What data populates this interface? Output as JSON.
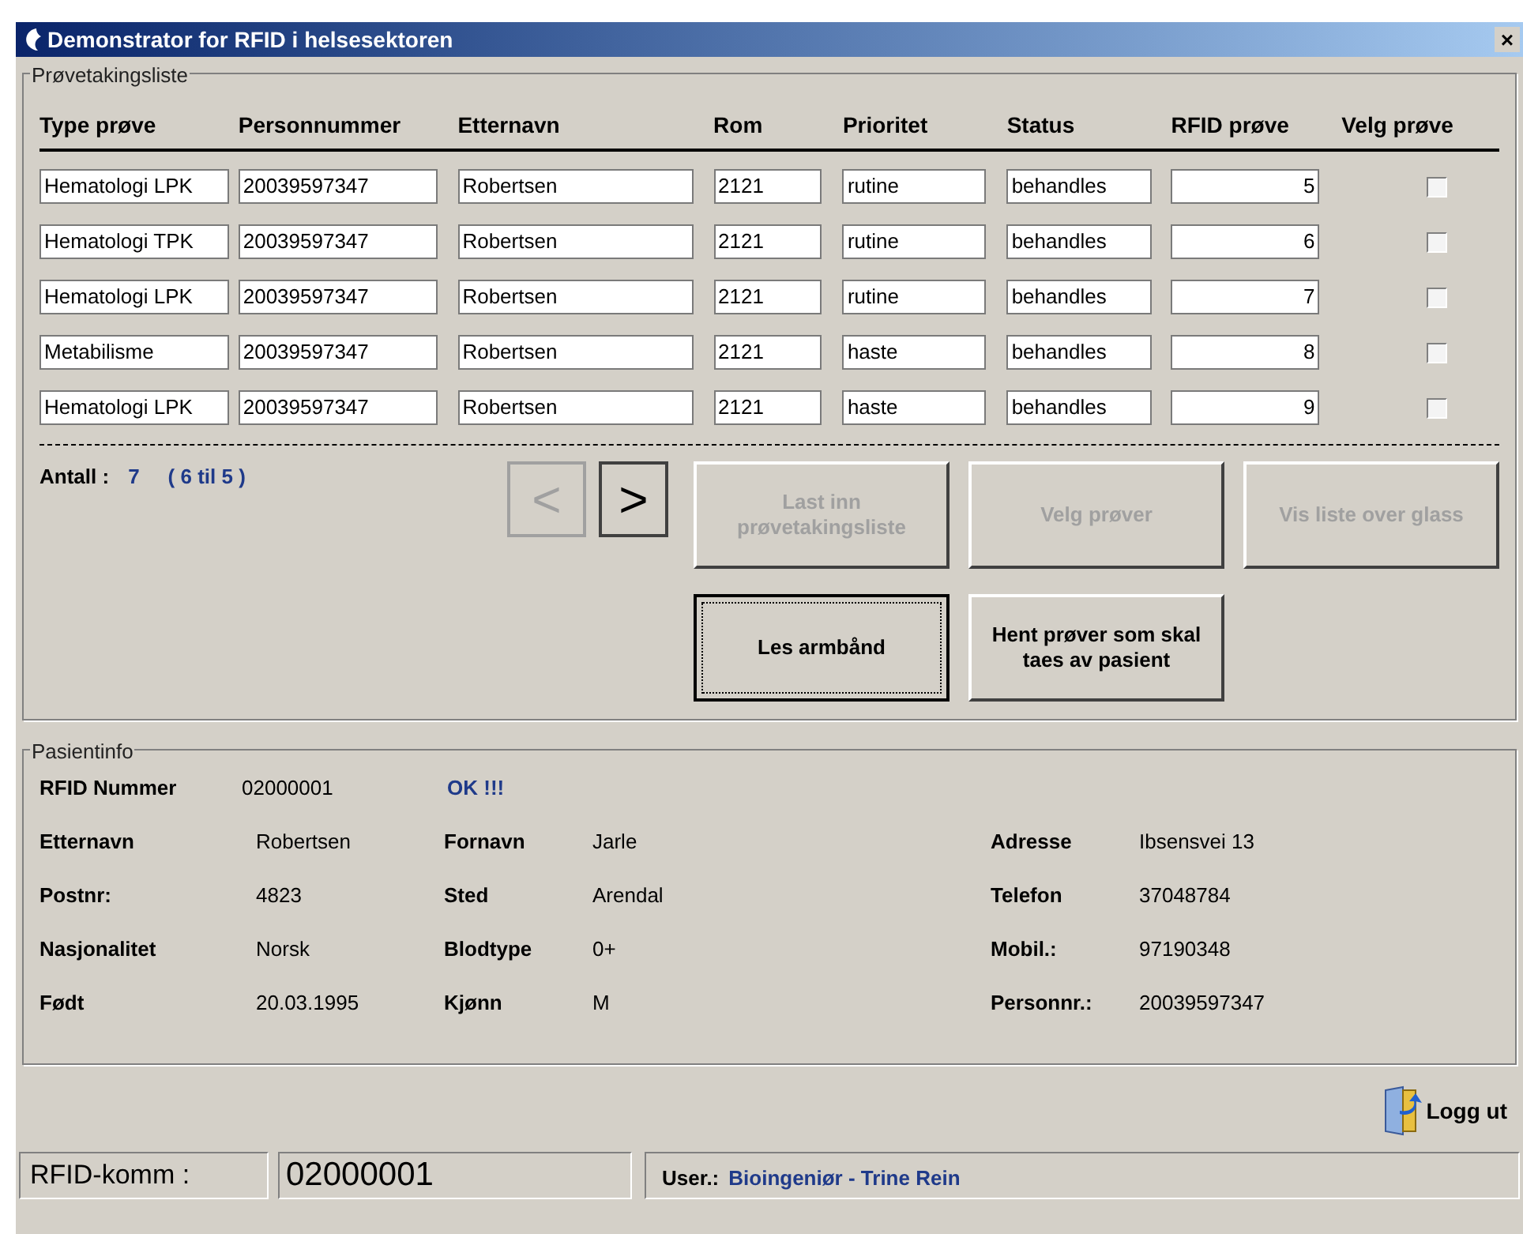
{
  "window": {
    "title": "Demonstrator for RFID i helsesektoren",
    "close": "×"
  },
  "sample_list": {
    "legend": "Prøvetakingsliste",
    "columns": [
      "Type prøve",
      "Personnummer",
      "Etternavn",
      "Rom",
      "Prioritet",
      "Status",
      "RFID prøve",
      "Velg prøve"
    ],
    "rows": [
      {
        "type": "Hematologi LPK",
        "personnummer": "20039597347",
        "etternavn": "Robertsen",
        "rom": "2121",
        "prioritet": "rutine",
        "status": "behandles",
        "rfid": "5",
        "checked": false
      },
      {
        "type": "Hematologi TPK",
        "personnummer": "20039597347",
        "etternavn": "Robertsen",
        "rom": "2121",
        "prioritet": "rutine",
        "status": "behandles",
        "rfid": "6",
        "checked": false
      },
      {
        "type": "Hematologi LPK",
        "personnummer": "20039597347",
        "etternavn": "Robertsen",
        "rom": "2121",
        "prioritet": "rutine",
        "status": "behandles",
        "rfid": "7",
        "checked": false
      },
      {
        "type": "Metabilisme",
        "personnummer": "20039597347",
        "etternavn": "Robertsen",
        "rom": "2121",
        "prioritet": "haste",
        "status": "behandles",
        "rfid": "8",
        "checked": false
      },
      {
        "type": "Hematologi LPK",
        "personnummer": "20039597347",
        "etternavn": "Robertsen",
        "rom": "2121",
        "prioritet": "haste",
        "status": "behandles",
        "rfid": "9",
        "checked": false
      }
    ],
    "count_label": "Antall :",
    "count": "7",
    "range": "( 6 til 5 )",
    "nav": [
      {
        "label": "<",
        "disabled": true
      },
      {
        "label": ">",
        "disabled": false
      }
    ],
    "buttons": [
      {
        "label": "Last inn prøvetakingsliste",
        "disabled": true,
        "focused": false
      },
      {
        "label": "Velg prøver",
        "disabled": true,
        "focused": false
      },
      {
        "label": "Vis liste over glass",
        "disabled": true,
        "focused": false
      },
      {
        "label": "Les armbånd",
        "disabled": false,
        "focused": true
      },
      {
        "label": "Hent prøver som skal taes av pasient",
        "disabled": false,
        "focused": false
      }
    ]
  },
  "patient": {
    "legend": "Pasientinfo",
    "rfid_label": "RFID Nummer",
    "rfid_value": "02000001",
    "rfid_status": "OK !!!",
    "rows": [
      [
        {
          "label": "Etternavn",
          "value": "Robertsen"
        },
        {
          "label": "Fornavn",
          "value": "Jarle"
        },
        {
          "label": "Adresse",
          "value": "Ibsensvei 13"
        }
      ],
      [
        {
          "label": "Postnr:",
          "value": "4823"
        },
        {
          "label": "Sted",
          "value": "Arendal"
        },
        {
          "label": "Telefon",
          "value": "37048784"
        }
      ],
      [
        {
          "label": "Nasjonalitet",
          "value": "Norsk"
        },
        {
          "label": "Blodtype",
          "value": "0+"
        },
        {
          "label": "Mobil.:",
          "value": "97190348"
        }
      ],
      [
        {
          "label": "Født",
          "value": "20.03.1995"
        },
        {
          "label": "Kjønn",
          "value": "M"
        },
        {
          "label": "Personnr.:",
          "value": "20039597347"
        }
      ]
    ]
  },
  "logout": "Logg ut",
  "status_bar": {
    "comm_label": "RFID-komm :",
    "comm_value": "02000001",
    "user_label": "User.:",
    "user": "Bioingeniør - Trine Rein"
  }
}
